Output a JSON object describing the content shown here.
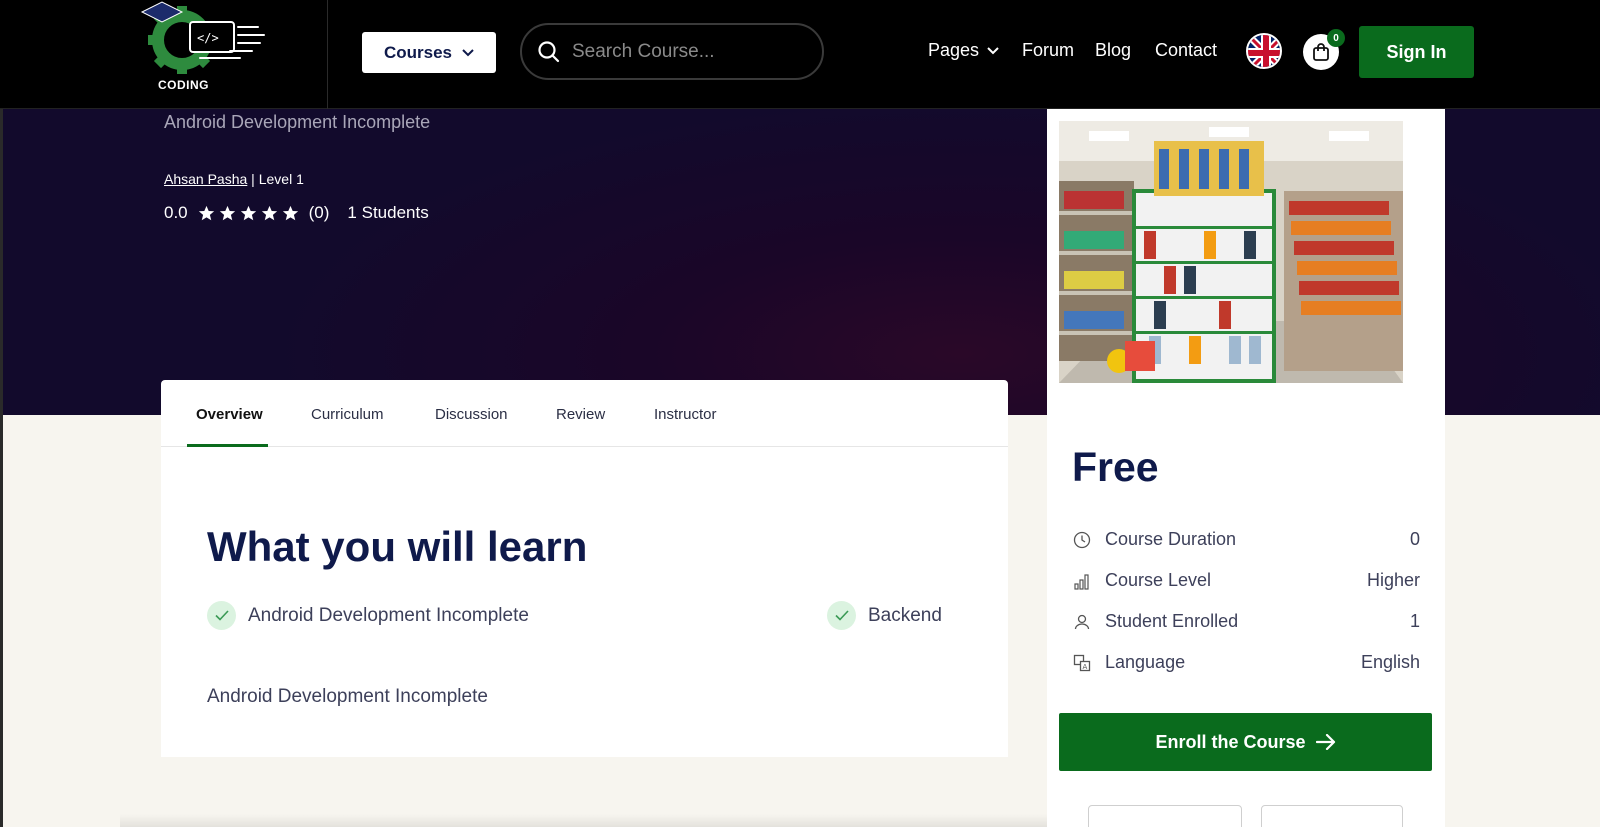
{
  "header": {
    "logo_text": "CODING",
    "courses_label": "Courses",
    "search_placeholder": "Search Course...",
    "nav": [
      {
        "label": "Pages",
        "has_dropdown": true
      },
      {
        "label": "Forum"
      },
      {
        "label": "Blog"
      },
      {
        "label": "Contact"
      }
    ],
    "cart_count": "0",
    "signin_label": "Sign In"
  },
  "hero": {
    "subtitle": "Android Development Incomplete",
    "instructor": "Ahsan Pasha",
    "separator_level": " | Level 1",
    "rating": "0.0",
    "rating_count": "(0)",
    "students": "1 Students",
    "star_rating_value": 0
  },
  "tabs": [
    {
      "label": "Overview",
      "active": true
    },
    {
      "label": "Curriculum"
    },
    {
      "label": "Discussion"
    },
    {
      "label": "Review"
    },
    {
      "label": "Instructor"
    }
  ],
  "overview": {
    "title": "What you will learn",
    "items": [
      "Android Development Incomplete",
      "Backend"
    ],
    "description": "Android Development Incomplete"
  },
  "sidebar": {
    "price": "Free",
    "info": [
      {
        "icon": "clock-icon",
        "label": "Course Duration",
        "value": "0"
      },
      {
        "icon": "level-bars-icon",
        "label": "Course Level",
        "value": "Higher"
      },
      {
        "icon": "users-icon",
        "label": "Student Enrolled",
        "value": "1"
      },
      {
        "icon": "language-icon",
        "label": "Language",
        "value": "English"
      }
    ],
    "enroll_label": "Enroll the Course"
  },
  "colors": {
    "brand_green": "#0a6b1d",
    "navy": "#0f1a4b",
    "hero_bg": "#140a2c"
  }
}
